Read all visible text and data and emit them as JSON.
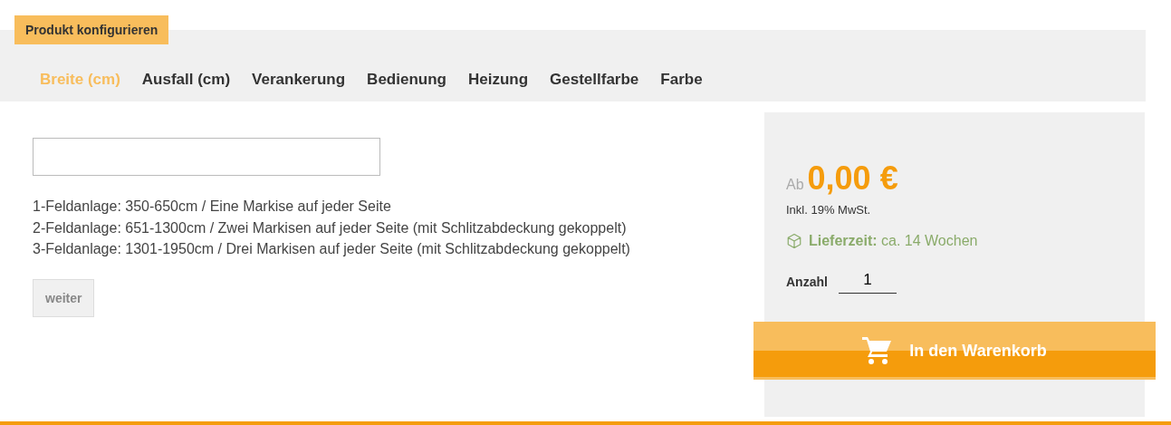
{
  "header_badge": "Produkt konfigurieren",
  "tabs": [
    {
      "label": "Breite (cm)",
      "selected": true
    },
    {
      "label": "Ausfall (cm)",
      "selected": false
    },
    {
      "label": "Verankerung",
      "selected": false
    },
    {
      "label": "Bedienung",
      "selected": false
    },
    {
      "label": "Heizung",
      "selected": false
    },
    {
      "label": "Gestellfarbe",
      "selected": false
    },
    {
      "label": "Farbe",
      "selected": false
    }
  ],
  "info_lines": [
    "1-Feldanlage: 350-650cm / Eine Markise auf jeder Seite",
    "2-Feldanlage: 651-1300cm / Zwei Markisen auf jeder Seite (mit Schlitzabdeckung gekoppelt)",
    "3-Feldanlage: 1301-1950cm / Drei Markisen auf jeder Seite (mit Schlitzabdeckung gekoppelt)"
  ],
  "next_button": "weiter",
  "price_panel": {
    "prefix": "Ab",
    "price": "0,00 €",
    "tax_note": "Inkl. 19% MwSt.",
    "delivery": "**Lieferzeit:** ca. 14 Wochen",
    "quantity_label": "Anzahl",
    "quantity": "1",
    "cart_button": "In den Warenkorb"
  }
}
